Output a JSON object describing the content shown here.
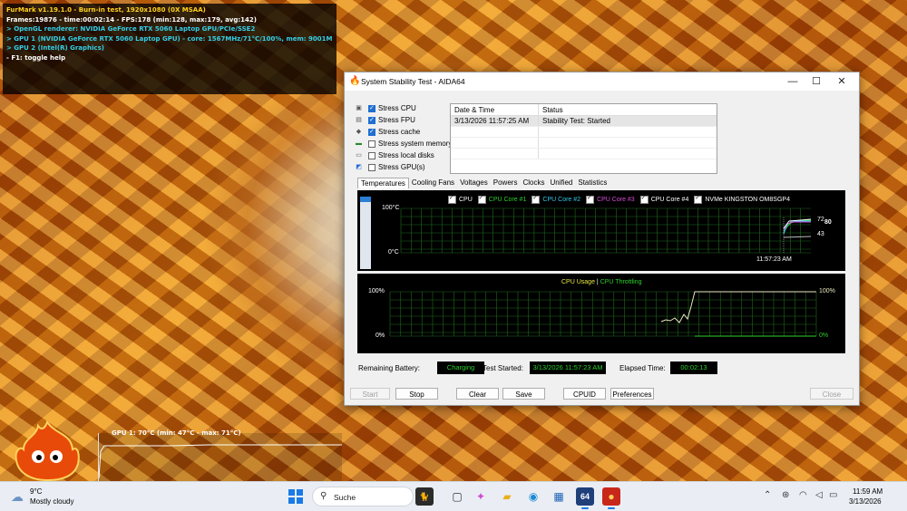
{
  "furmark": {
    "lines": [
      "FurMark v1.19.1.0 - Burn-in test, 1920x1080 (0X MSAA)",
      "Frames:19876 - time:00:02:14 - FPS:178 (min:128, max:179, avg:142)",
      "> OpenGL renderer: NVIDIA GeForce RTX 5060 Laptop GPU/PCIe/SSE2",
      "> GPU 1 (NVIDIA GeForce RTX 5060 Laptop GPU) - core: 1567MHz/71°C/100%, mem: 9001MHz/4%, limits:[power:1, temp:0, volt:0, OV:0]",
      "> GPU 2 (Intel(R) Graphics)",
      "- F1: toggle help"
    ],
    "gpu_graph_label": "GPU 1: 70°C (min: 47°C - max: 71°C)"
  },
  "window": {
    "title": "System Stability Test - AIDA64",
    "minimize": "—",
    "maximize": "☐",
    "close": "✕"
  },
  "stress_options": [
    {
      "label": "Stress CPU",
      "checked": true,
      "icon": "cpu-icon"
    },
    {
      "label": "Stress FPU",
      "checked": true,
      "icon": "fpu-icon"
    },
    {
      "label": "Stress cache",
      "checked": true,
      "icon": "cache-icon"
    },
    {
      "label": "Stress system memory",
      "checked": false,
      "icon": "memory-icon"
    },
    {
      "label": "Stress local disks",
      "checked": false,
      "icon": "disk-icon"
    },
    {
      "label": "Stress GPU(s)",
      "checked": false,
      "icon": "gpu-icon"
    }
  ],
  "status_table": {
    "headers": [
      "Date & Time",
      "Status"
    ],
    "rows": [
      [
        "3/13/2026 11:57:25 AM",
        "Stability Test: Started"
      ]
    ]
  },
  "tabs": [
    "Temperatures",
    "Cooling Fans",
    "Voltages",
    "Powers",
    "Clocks",
    "Unified",
    "Statistics"
  ],
  "temp_legend": [
    {
      "label": "CPU",
      "color": "#ffffff"
    },
    {
      "label": "CPU Core #1",
      "color": "#2bd12b"
    },
    {
      "label": "CPU Core #2",
      "color": "#33c9e8"
    },
    {
      "label": "CPU Core #3",
      "color": "#d84ad8"
    },
    {
      "label": "CPU Core #4",
      "color": "#ffffff"
    },
    {
      "label": "NVMe KINGSTON OM8SGP4",
      "color": "#ffffff"
    }
  ],
  "temp_chart": {
    "y_top": "100°C",
    "y_bottom": "0°C",
    "time_label": "11:57:23 AM",
    "values": [
      "72",
      "80",
      "43"
    ]
  },
  "cpu_chart": {
    "legend_a": "CPU Usage",
    "legend_sep": "|",
    "legend_b": "CPU Throttling",
    "y_top_left": "100%",
    "y_bottom_left": "0%",
    "y_top_right": "100%",
    "y_bottom_right": "0%"
  },
  "info": {
    "battery_label": "Remaining Battery:",
    "battery_value": "Charging",
    "started_label": "Test Started:",
    "started_value": "3/13/2026 11:57:23 AM",
    "elapsed_label": "Elapsed Time:",
    "elapsed_value": "00:02:13"
  },
  "buttons": {
    "start": "Start",
    "stop": "Stop",
    "clear": "Clear",
    "save": "Save",
    "cpuid": "CPUID",
    "preferences": "Preferences",
    "close": "Close"
  },
  "taskbar": {
    "weather_temp": "9°C",
    "weather_desc": "Mostly cloudy",
    "search_placeholder": "Suche",
    "time": "11:59 AM",
    "date": "3/13/2026"
  }
}
